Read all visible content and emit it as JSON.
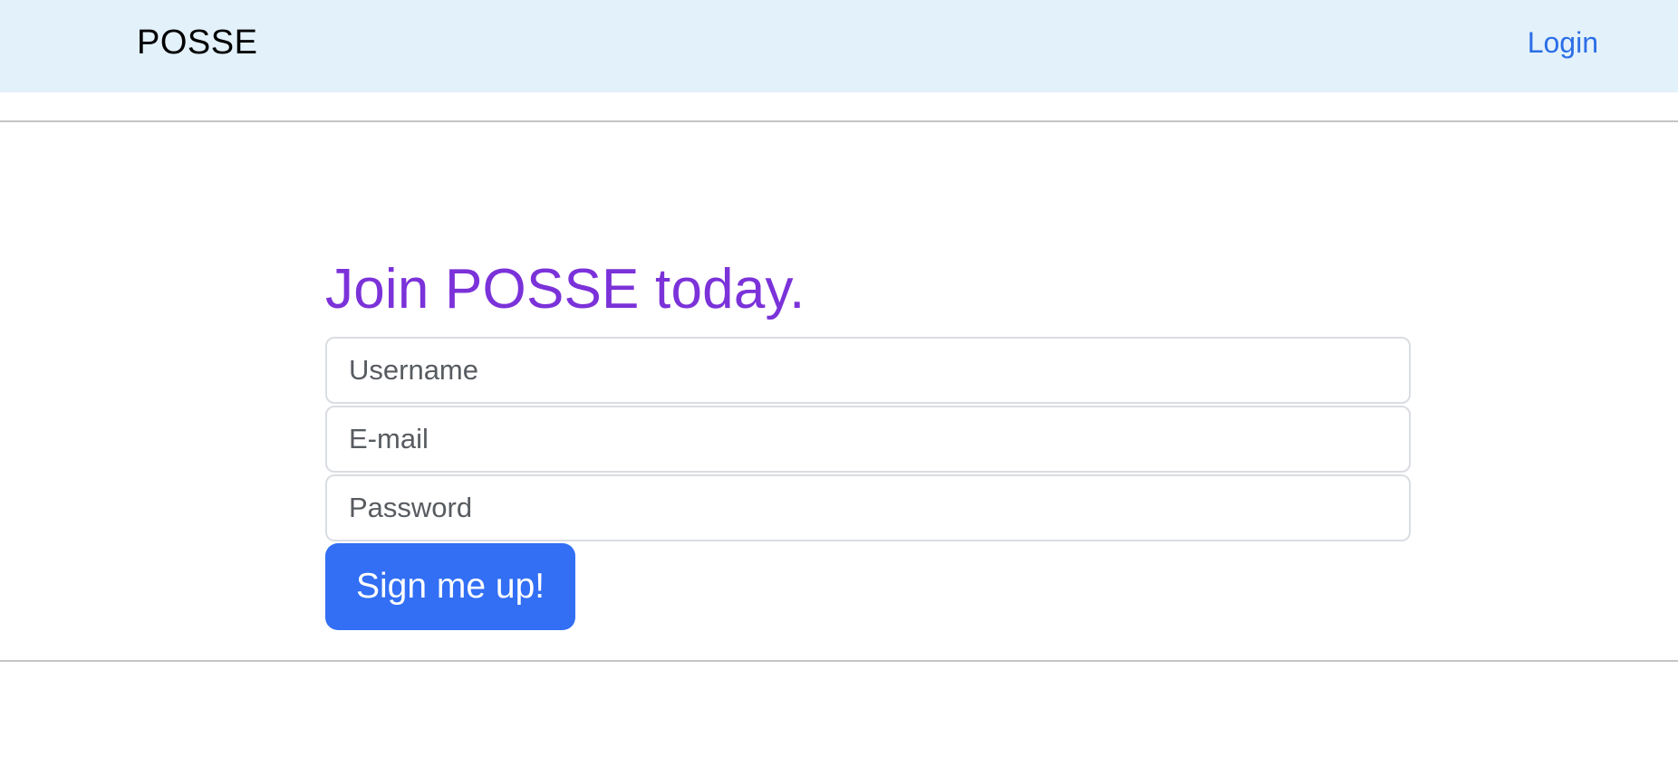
{
  "navbar": {
    "brand": "POSSE",
    "login_label": "Login",
    "background": "#e3f1fb",
    "link_color": "#2c6ee6"
  },
  "signup": {
    "heading": "Join POSSE today.",
    "heading_color": "#7b32d9",
    "username_placeholder": "Username",
    "email_placeholder": "E-mail",
    "password_placeholder": "Password",
    "submit_label": "Sign me up!",
    "button_color": "#326ff4"
  }
}
